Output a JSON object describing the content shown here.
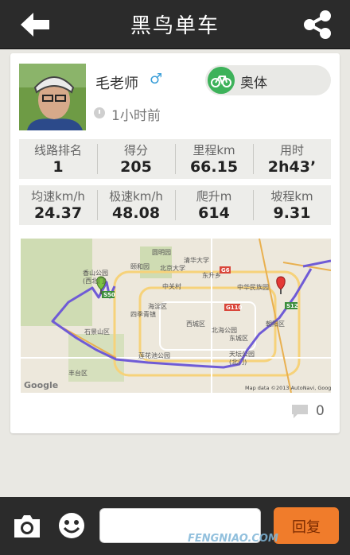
{
  "header": {
    "title": "黑鸟单车",
    "back_icon": "back-arrow-icon",
    "share_icon": "share-icon"
  },
  "post": {
    "user_name": "毛老师",
    "gender_symbol": "♂",
    "time_ago": "1小时前",
    "sport_label": "奥体",
    "sport_icon": "bicycle-icon"
  },
  "stats_row1": [
    {
      "label": "线路排名",
      "value": "1"
    },
    {
      "label": "得分",
      "value": "205"
    },
    {
      "label": "里程km",
      "value": "66.15"
    },
    {
      "label": "用时",
      "value": "2h43’"
    }
  ],
  "stats_row2": [
    {
      "label": "均速km/h",
      "value": "24.37"
    },
    {
      "label": "极速km/h",
      "value": "48.08"
    },
    {
      "label": "爬升m",
      "value": "614"
    },
    {
      "label": "坡程km",
      "value": "9.31"
    }
  ],
  "map": {
    "labels": {
      "l1": "香山公园",
      "l2": "(西北门)",
      "l3": "圆明园",
      "l4": "清华大学",
      "l5": "颐和园",
      "l6": "北京大学",
      "l7": "中关村",
      "l8": "东升乡",
      "l9": "海淀区",
      "l10": "四季青镇",
      "l11": "中华民族园",
      "l12": "朝阳区",
      "l13": "西城区",
      "l14": "北海公园",
      "l15": "东城区",
      "l16": "石景山区",
      "l17": "天坛公园",
      "l18": "(北门)",
      "l19": "丰台区",
      "l20": "莲花池公园",
      "r1": "S50",
      "r2": "S12",
      "r3": "G6",
      "r4": "G110",
      "google": "Google",
      "attribution": "Map data ©2013 AutoNavi, Google"
    },
    "route_color": "#6f5bd6",
    "start_pin_color": "#7cc143",
    "end_pin_color": "#e53935"
  },
  "comments": {
    "count": "0"
  },
  "footer": {
    "camera_icon": "camera-icon",
    "emoji_icon": "emoji-icon",
    "input_placeholder": "",
    "reply_label": "回复"
  },
  "watermark": "FENGNIAO.COM"
}
